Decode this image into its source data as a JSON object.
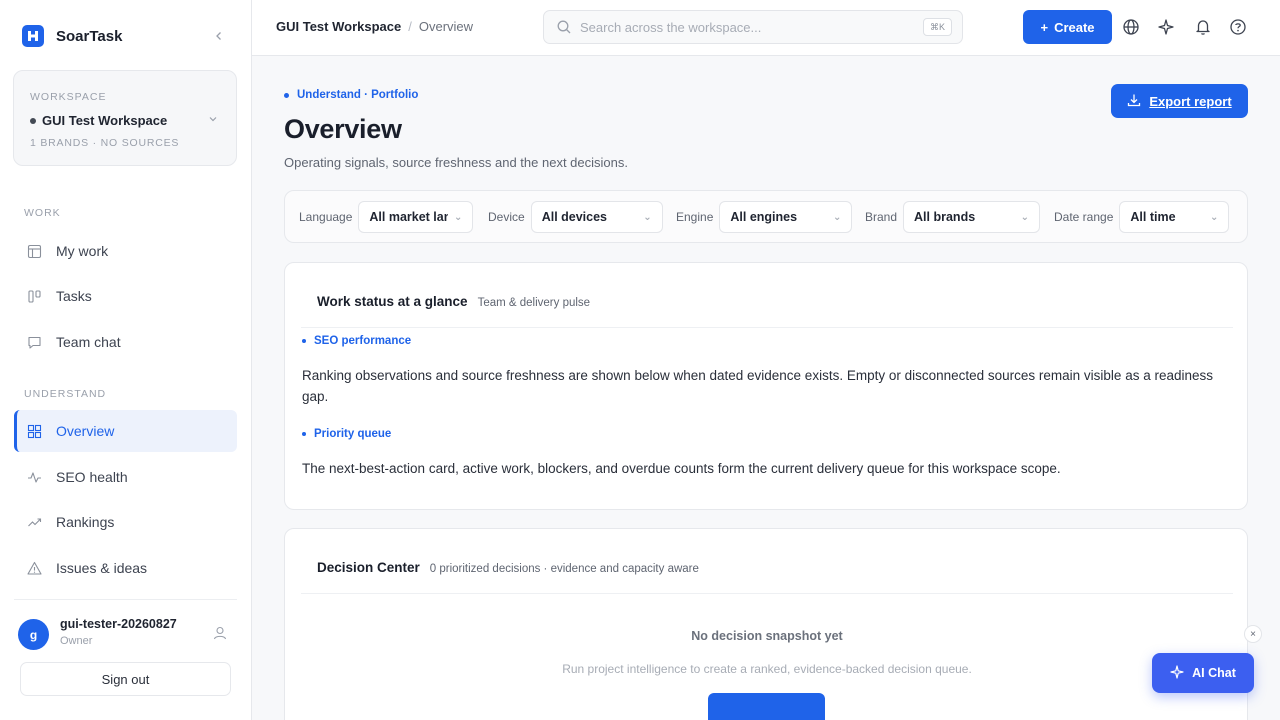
{
  "app": {
    "name": "SoarTask"
  },
  "workspace": {
    "label": "WORKSPACE",
    "name": "GUI Test Workspace",
    "meta": "1 BRANDS · NO SOURCES"
  },
  "sidebar": {
    "work_label": "WORK",
    "work_items": [
      {
        "label": "My work",
        "icon": "layout-icon"
      },
      {
        "label": "Tasks",
        "icon": "kanban-icon"
      },
      {
        "label": "Team chat",
        "icon": "chat-icon"
      }
    ],
    "understand_label": "UNDERSTAND",
    "understand_items": [
      {
        "label": "Overview",
        "icon": "grid-icon",
        "active": true
      },
      {
        "label": "SEO health",
        "icon": "pulse-icon"
      },
      {
        "label": "Rankings",
        "icon": "trend-icon"
      },
      {
        "label": "Issues & ideas",
        "icon": "warning-icon"
      }
    ]
  },
  "user": {
    "initial": "g",
    "name": "gui-tester-20260827",
    "role": "Owner",
    "sign_out": "Sign out"
  },
  "topbar": {
    "breadcrumb_workspace": "GUI Test Workspace",
    "breadcrumb_separator": "/",
    "breadcrumb_page": "Overview",
    "search_placeholder": "Search across the workspace...",
    "search_shortcut": "⌘K",
    "create_label": "Create"
  },
  "page": {
    "eyebrow": "Understand · Portfolio",
    "title": "Overview",
    "subtitle": "Operating signals, source freshness and the next decisions.",
    "export_label": "Export report"
  },
  "filters": [
    {
      "label": "Language",
      "value": "All market languages"
    },
    {
      "label": "Device",
      "value": "All devices"
    },
    {
      "label": "Engine",
      "value": "All engines"
    },
    {
      "label": "Brand",
      "value": "All brands"
    },
    {
      "label": "Date range",
      "value": "All time"
    }
  ],
  "work_status": {
    "title": "Work status at a glance",
    "subtitle": "Team & delivery pulse",
    "sections": [
      {
        "tag": "SEO performance",
        "text": "Ranking observations and source freshness are shown below when dated evidence exists. Empty or disconnected sources remain visible as a readiness gap."
      },
      {
        "tag": "Priority queue",
        "text": "The next-best-action card, active work, blockers, and overdue counts form the current delivery queue for this workspace scope."
      }
    ]
  },
  "decision_center": {
    "title": "Decision Center",
    "subtitle": "0 prioritized decisions · evidence and capacity aware",
    "empty_title": "No decision snapshot yet",
    "empty_text": "Run project intelligence to create a ranked, evidence-backed decision queue."
  },
  "ai_chat": {
    "label": "AI Chat",
    "close": "×"
  },
  "colors": {
    "accent": "#1f63e9",
    "ai_chat": "#3c5ff0"
  }
}
